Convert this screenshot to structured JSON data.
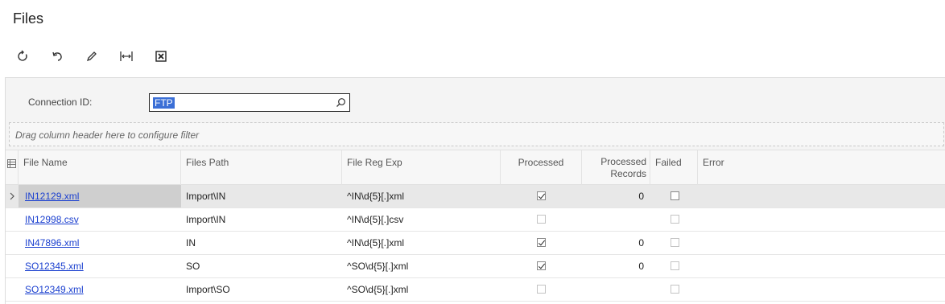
{
  "page": {
    "title": "Files"
  },
  "toolbar": {
    "buttons": [
      {
        "name": "refresh-button",
        "icon": "refresh-icon"
      },
      {
        "name": "undo-button",
        "icon": "undo-icon"
      },
      {
        "name": "edit-button",
        "icon": "pencil-icon"
      },
      {
        "name": "fit-columns-button",
        "icon": "fit-width-icon"
      },
      {
        "name": "export-excel-button",
        "icon": "excel-icon"
      }
    ]
  },
  "filter": {
    "connection_label": "Connection ID:",
    "connection_value": "FTP",
    "drag_hint": "Drag column header here to configure filter"
  },
  "grid": {
    "columns": {
      "file_name": "File Name",
      "files_path": "Files Path",
      "file_reg_exp": "File Reg Exp",
      "processed": "Processed",
      "processed_records_1": "Processed",
      "processed_records_2": "Records",
      "failed": "Failed",
      "error": "Error"
    },
    "rows": [
      {
        "file_name": "IN12129.xml",
        "files_path": "Import\\IN",
        "file_reg_exp": "^IN\\d{5}[.]xml",
        "processed": true,
        "processed_records": "0",
        "failed": false,
        "error": "",
        "active": true
      },
      {
        "file_name": "IN12998.csv",
        "files_path": "Import\\IN",
        "file_reg_exp": "^IN\\d{5}[.]csv",
        "processed": false,
        "processed_records": "",
        "failed": false,
        "error": "",
        "active": false
      },
      {
        "file_name": "IN47896.xml",
        "files_path": "IN",
        "file_reg_exp": "^IN\\d{5}[.]xml",
        "processed": true,
        "processed_records": "0",
        "failed": false,
        "error": "",
        "active": false
      },
      {
        "file_name": "SO12345.xml",
        "files_path": "SO",
        "file_reg_exp": "^SO\\d{5}[.]xml",
        "processed": true,
        "processed_records": "0",
        "failed": false,
        "error": "",
        "active": false
      },
      {
        "file_name": "SO12349.xml",
        "files_path": "Import\\SO",
        "file_reg_exp": "^SO\\d{5}[.]xml",
        "processed": false,
        "processed_records": "",
        "failed": false,
        "error": "",
        "active": false
      }
    ]
  }
}
